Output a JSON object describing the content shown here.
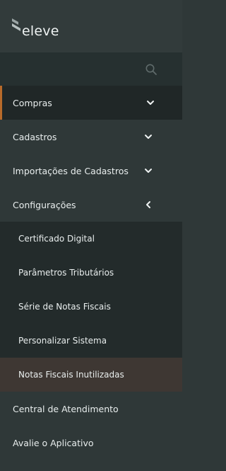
{
  "brand": {
    "logo_text": "eleve",
    "logo_icon": "eleve-logo-icon"
  },
  "search": {
    "icon": "search-icon"
  },
  "menu": {
    "items": [
      {
        "label": "Compras",
        "icon": "chevron-down-icon",
        "active": true
      },
      {
        "label": "Cadastros",
        "icon": "chevron-down-icon"
      },
      {
        "label": "Importações de Cadastros",
        "icon": "chevron-down-icon"
      },
      {
        "label": "Configurações",
        "icon": "chevron-left-icon",
        "expanded": true
      },
      {
        "label": "Central de Atendimento"
      },
      {
        "label": "Avalie o Aplicativo"
      }
    ],
    "submenu": [
      {
        "label": "Certificado Digital"
      },
      {
        "label": "Parâmetros Tributários"
      },
      {
        "label": "Série de Notas Fiscais"
      },
      {
        "label": "Personalizar Sistema"
      },
      {
        "label": "Notas Fiscais Inutilizadas",
        "selected": true
      }
    ]
  },
  "colors": {
    "sidebar_bg": "#2f3838",
    "search_bg": "#263030",
    "active_bg": "#202727",
    "active_accent": "#b86a2a",
    "submenu_bg": "#232b2b",
    "selected_bg": "#3e3733",
    "text": "#e9eeee"
  }
}
